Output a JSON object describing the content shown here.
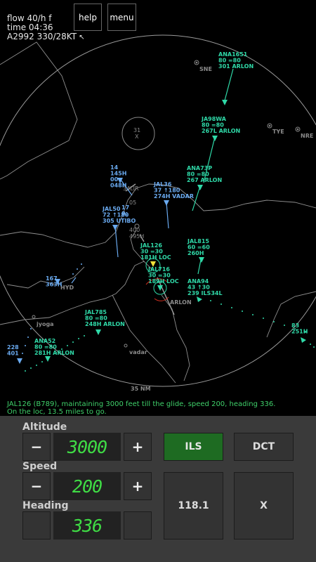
{
  "hud": {
    "flow": "flow 40/h f",
    "time": "time 04:36",
    "weather": "A2992 330/28KT"
  },
  "top_buttons": {
    "help": "help",
    "menu": "menu"
  },
  "map": {
    "places": [
      {
        "name": "SNE"
      },
      {
        "name": "TYE"
      },
      {
        "name": "NRE"
      },
      {
        "name": "jyoga"
      },
      {
        "name": "vadar"
      },
      {
        "name": "ARLON"
      },
      {
        "name": "HYD"
      }
    ],
    "range_label": "35 NM",
    "holding_label": "31",
    "holding_sub": "X",
    "fixes": {
      "f1": "34LIR",
      "f2": "05",
      "f3": "400",
      "f4": "495H"
    }
  },
  "aircraft": [
    {
      "lines": [
        "ANA1651",
        "80 =80",
        "301  ARLON"
      ],
      "color": "#2fd9a8"
    },
    {
      "lines": [
        "JA98WA",
        "80 =80",
        "267L ARLON"
      ],
      "color": "#2fd9a8"
    },
    {
      "lines": [
        "ANA73P",
        "80 =80",
        "267  ARLON"
      ],
      "color": "#2fd9a8"
    },
    {
      "lines": [
        "14",
        "145H",
        "00",
        "048H"
      ],
      "color": "#6aaaf0"
    },
    {
      "lines": [
        "JAL36",
        "37 ↑180",
        "274H VADAR"
      ],
      "color": "#6aaaf0"
    },
    {
      "lines": [
        "JAL50",
        "72 ↑180",
        "305  UTIBO"
      ],
      "color": "#6aaaf0"
    },
    {
      "lines": [
        "17",
        "0:"
      ],
      "color": "#6aaaf0"
    },
    {
      "lines": [
        "JAL126",
        "30 =30",
        "181H LOC"
      ],
      "color": "#2fd9a8"
    },
    {
      "lines": [
        "JAL815",
        "60 =60",
        "260H"
      ],
      "color": "#2fd9a8"
    },
    {
      "lines": [
        "JAL716",
        "30 =30",
        "189H LOC"
      ],
      "color": "#2fd9a8"
    },
    {
      "lines": [
        "ANA94",
        "43 ↑30",
        "239  ILS34L"
      ],
      "color": "#2fd9a8"
    },
    {
      "lines": [
        "167",
        "363H"
      ],
      "color": "#6aaaf0"
    },
    {
      "lines": [
        "JAL785",
        "80 =80",
        "248H ARLON"
      ],
      "color": "#2fd9a8"
    },
    {
      "lines": [
        "ANA52",
        "80 =80",
        "281H ARLON"
      ],
      "color": "#2fd9a8"
    },
    {
      "lines": [
        "228",
        "401"
      ],
      "color": "#6aaaf0"
    },
    {
      "lines": [
        "83",
        "251H"
      ],
      "color": "#2fd9a8"
    }
  ],
  "message": {
    "line1": "JAL126 (B789), maintaining 3000 feet till the glide, speed 200, heading 336.",
    "line2": "On the loc, 13.5 miles to go."
  },
  "controls": {
    "altitude": {
      "label": "Altitude",
      "value": "3000",
      "minus": "−",
      "plus": "+"
    },
    "speed": {
      "label": "Speed",
      "value": "200",
      "minus": "−",
      "plus": "+"
    },
    "heading": {
      "label": "Heading",
      "value": "336"
    },
    "ils_label": "ILS",
    "dct_label": "DCT",
    "freq_label": "118.1",
    "cancel_label": "X"
  },
  "colors": {
    "arrival": "#2fd9a8",
    "departure": "#6aaaf0",
    "message": "#3fd06a",
    "lcd": "#3fdc45",
    "ils_active": "#1e6b22"
  }
}
